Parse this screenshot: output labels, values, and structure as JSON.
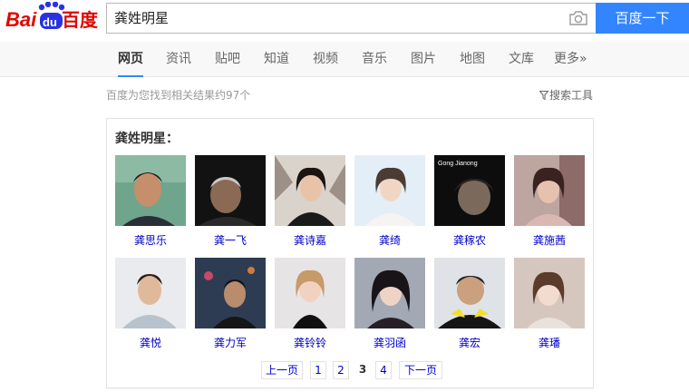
{
  "logo": {
    "text_left": "Bai",
    "text_paw": "du",
    "text_right": "百度"
  },
  "search": {
    "query": "龚姓明星",
    "button_label": "百度一下"
  },
  "nav": {
    "items": [
      {
        "label": "网页",
        "active": true
      },
      {
        "label": "资讯"
      },
      {
        "label": "贴吧"
      },
      {
        "label": "知道"
      },
      {
        "label": "视频"
      },
      {
        "label": "音乐"
      },
      {
        "label": "图片"
      },
      {
        "label": "地图"
      },
      {
        "label": "文库"
      },
      {
        "label": "更多»"
      }
    ]
  },
  "stats": {
    "text": "百度为您找到相关结果约97个",
    "tools_label": "搜索工具"
  },
  "card": {
    "title": "龚姓明星：",
    "people": [
      {
        "name": "龚思乐"
      },
      {
        "name": "龚一飞"
      },
      {
        "name": "龚诗嘉"
      },
      {
        "name": "龚绮"
      },
      {
        "name": "龚稼农"
      },
      {
        "name": "龚施茜"
      },
      {
        "name": "龚悦"
      },
      {
        "name": "龚力军"
      },
      {
        "name": "龚铃铃"
      },
      {
        "name": "龚羽函"
      },
      {
        "name": "龚宏"
      },
      {
        "name": "龚璠"
      }
    ],
    "photo_caption": "Gong Jianong"
  },
  "pager": {
    "prev": "上一页",
    "pages": [
      "1",
      "2",
      "3",
      "4"
    ],
    "current": "3",
    "next": "下一页"
  }
}
